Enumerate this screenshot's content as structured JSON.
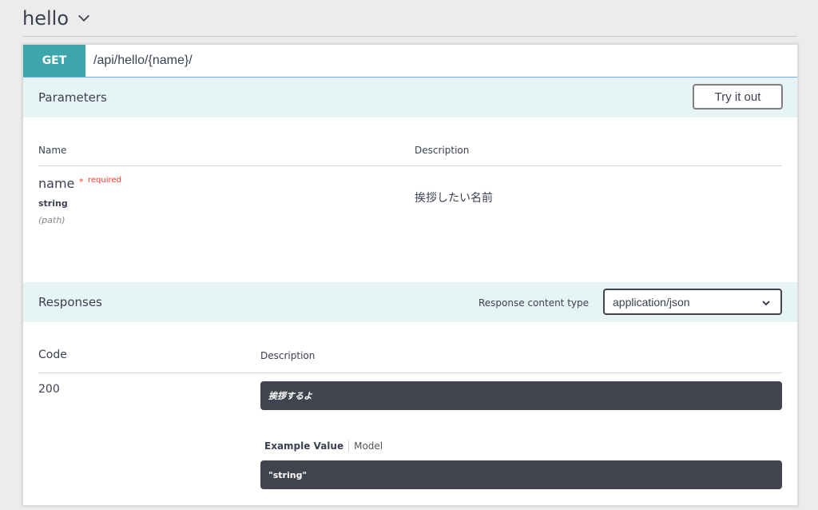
{
  "tag": {
    "title": "hello",
    "chevron_icon": "chevron-down-icon"
  },
  "operation": {
    "method": "GET",
    "path": "/api/hello/{name}/",
    "method_color": "#3da7ad"
  },
  "parameters": {
    "title": "Parameters",
    "try_it_out_label": "Try it out",
    "columns": {
      "name": "Name",
      "description": "Description"
    },
    "items": [
      {
        "name": "name",
        "required_star": "*",
        "required_label": "required",
        "type": "string",
        "in": "(path)",
        "description": "挨拶したい名前"
      }
    ]
  },
  "responses": {
    "title": "Responses",
    "content_type_label": "Response content type",
    "content_type_value": "application/json",
    "columns": {
      "code": "Code",
      "description": "Description"
    },
    "items": [
      {
        "code": "200",
        "description": "挨拶するよ",
        "example_tab": "Example Value",
        "model_tab": "Model",
        "example_value": "\"string\""
      }
    ]
  }
}
